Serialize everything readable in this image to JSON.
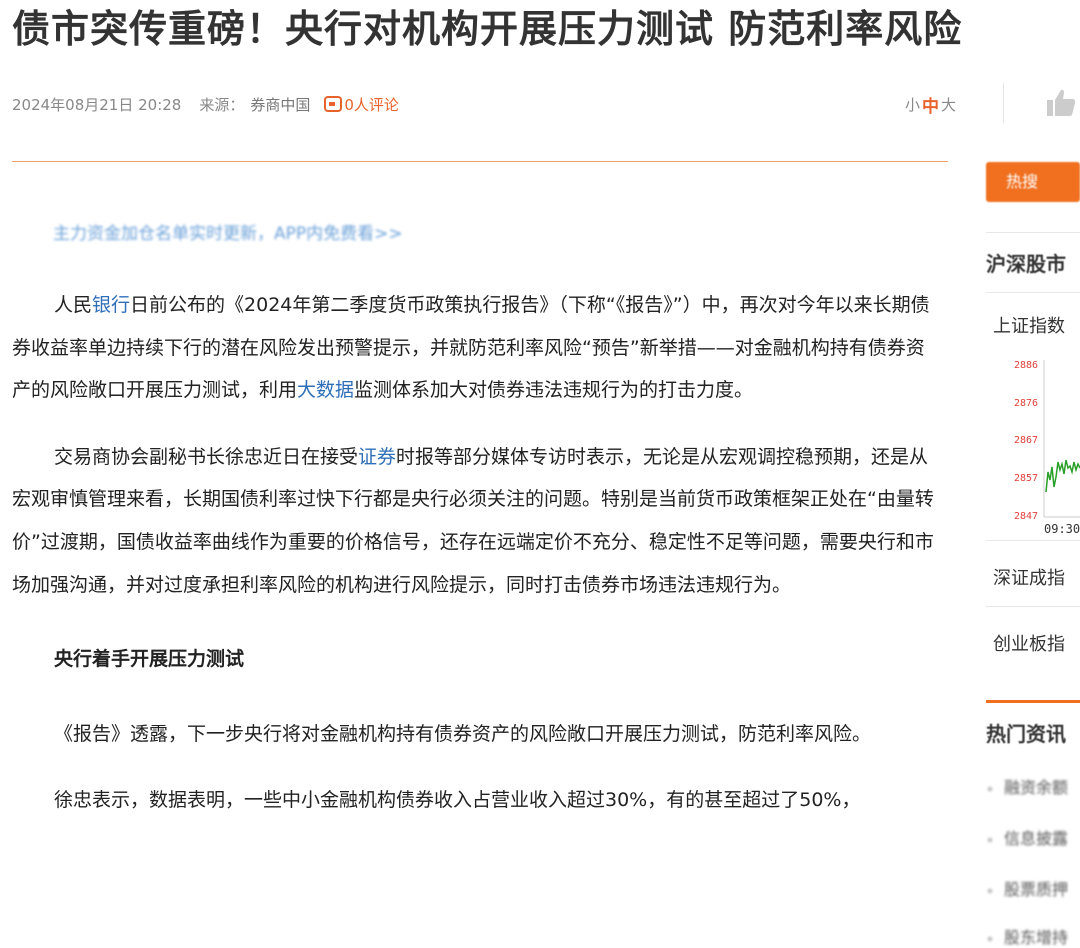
{
  "article": {
    "title": "债市突传重磅！央行对机构开展压力测试 防范利率风险",
    "date": "2024年08月21日 20:28",
    "source_label": "来源：",
    "source": "券商中国",
    "comments": "0人评论",
    "font_controls": [
      "小",
      "中",
      "大"
    ],
    "promo": "主力资金加仓名单实时更新，APP内免费看>>",
    "p1": {
      "a": "人民",
      "k1": "银行",
      "b": "日前公布的《2024年第二季度货币政策执行报告》（下称“《报告》”）中，再次对今年以来长期债券收益率单边持续下行的潜在风险发出预警提示，并就防范利率风险“预告”新举措——对金融机构持有债券资产的风险敞口开展压力测试，利用",
      "k2": "大数据",
      "c": "监测体系加大对债券违法违规行为的打击力度。"
    },
    "p2": {
      "a": "交易商协会副秘书长徐忠近日在接受",
      "k1": "证券",
      "b": "时报等部分媒体专访时表示，无论是从宏观调控稳预期，还是从宏观审慎管理来看，长期国债利率过快下行都是央行必须关注的问题。特别是当前货币政策框架正处在“由量转价”过渡期，国债收益率曲线作为重要的价格信号，还存在远端定价不充分、稳定性不足等问题，需要央行和市场加强沟通，并对过度承担利率风险的机构进行风险提示，同时打击债券市场违法违规行为。"
    },
    "subheading": "央行着手开展压力测试",
    "p3": "《报告》透露，下一步央行将对金融机构持有债券资产的风险敞口开展压力测试，防范利率风险。",
    "p4": "徐忠表示，数据表明，一些中小金融机构债券收入占营业收入超过30%，有的甚至超过了50%，"
  },
  "sidebar": {
    "tab": "热搜",
    "market_title": "沪深股市",
    "indices": [
      "上证指数",
      "深证成指",
      "创业板指"
    ],
    "chart_ticks": [
      "2886",
      "2876",
      "2867",
      "2857",
      "2847"
    ],
    "chart_time": "09:30",
    "hot_title": "热门资讯",
    "hot_items": [
      "融资余额",
      "信息披露",
      "股票质押",
      "股东增持"
    ]
  },
  "colors": {
    "accent": "#f07020",
    "link": "#2f6fb8"
  }
}
